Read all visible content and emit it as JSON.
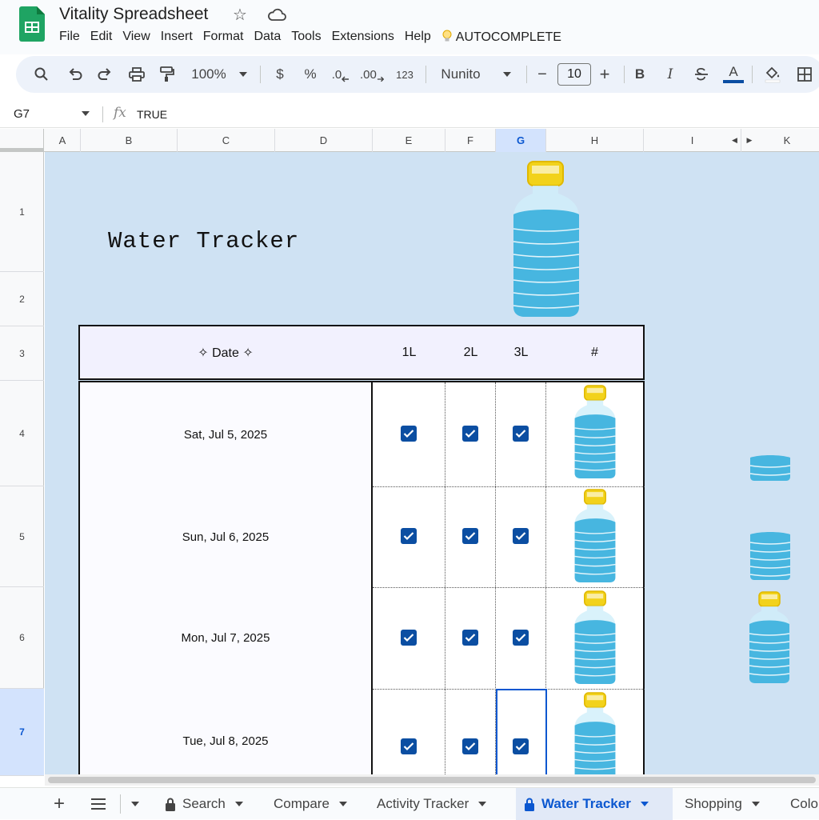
{
  "app": {
    "doc_title": "Vitality Spreadsheet",
    "menu": [
      "File",
      "Edit",
      "View",
      "Insert",
      "Format",
      "Data",
      "Tools",
      "Extensions",
      "Help"
    ],
    "autocomplete_label": "AUTOCOMPLETE"
  },
  "toolbar": {
    "zoom": "100%",
    "currency": "$",
    "percent": "%",
    "decrease_decimal": ".0",
    "increase_decimal": ".00",
    "number_format": "123",
    "font": "Nunito",
    "font_size": "10",
    "minus": "−",
    "plus": "+",
    "bold": "B",
    "italic": "I",
    "text_color": "A"
  },
  "formula_bar": {
    "cell_ref": "G7",
    "fx": "fx",
    "value": "TRUE"
  },
  "columns": [
    "A",
    "B",
    "C",
    "D",
    "E",
    "F",
    "G",
    "H",
    "I",
    "K"
  ],
  "rows": [
    "1",
    "2",
    "3",
    "4",
    "5",
    "6",
    "7"
  ],
  "sheet": {
    "title": "Water Tracker",
    "header": {
      "date": "✧ Date ✧",
      "col_1l": "1L",
      "col_2l": "2L",
      "col_3l": "3L",
      "col_count": "#"
    },
    "entries": [
      {
        "date": "Sat, Jul 5, 2025",
        "l1": true,
        "l2": true,
        "l3": true
      },
      {
        "date": "Sun, Jul 6, 2025",
        "l1": true,
        "l2": true,
        "l3": true
      },
      {
        "date": "Mon, Jul 7, 2025",
        "l1": true,
        "l2": true,
        "l3": true
      },
      {
        "date": "Tue, Jul 8, 2025",
        "l1": true,
        "l2": true,
        "l3": true
      }
    ]
  },
  "tabs": {
    "list": [
      {
        "label": "Search",
        "locked": true
      },
      {
        "label": "Compare",
        "locked": false
      },
      {
        "label": "Activity Tracker",
        "locked": false
      },
      {
        "label": "Water Tracker",
        "locked": true,
        "active": true
      },
      {
        "label": "Shopping",
        "locked": false
      },
      {
        "label": "Colo",
        "locked": false
      }
    ]
  },
  "colors": {
    "accent": "#0b57d0",
    "checkbox": "#0b4ea2",
    "sheet_bg": "#cfe2f3",
    "header_fill": "#f2f1fe",
    "water": "#47b6e0",
    "cap": "#f2d21b"
  }
}
